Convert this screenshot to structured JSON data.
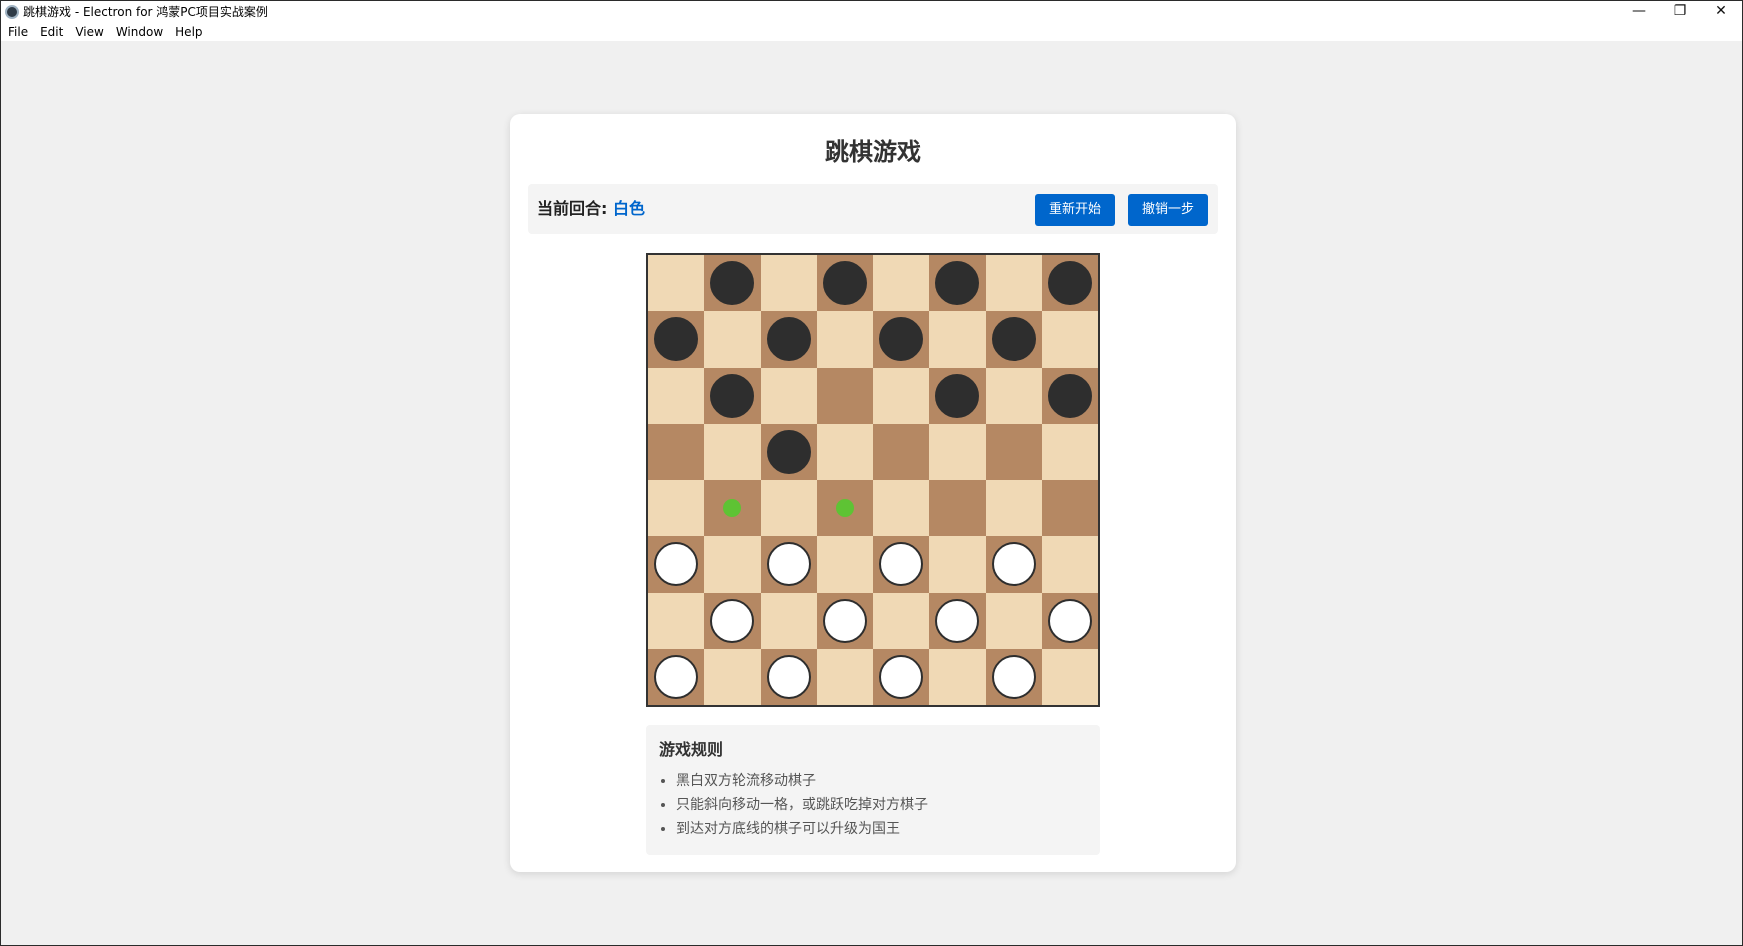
{
  "window": {
    "title": "跳棋游戏 - Electron for 鸿蒙PC项目实战案例",
    "minimize_glyph": "—",
    "restore_glyph": "❐",
    "close_glyph": "✕"
  },
  "menu": [
    "File",
    "Edit",
    "View",
    "Window",
    "Help"
  ],
  "game": {
    "title": "跳棋游戏",
    "turn_label": "当前回合: ",
    "turn_value": "白色",
    "restart_label": "重新开始",
    "undo_label": "撤销一步"
  },
  "board": {
    "size": 8,
    "light_color": "#f0d9b5",
    "dark_color": "#b58863",
    "rows": [
      ".B.B.B.B",
      "B.B.B.B.",
      ".B...B.B",
      "..B.....",
      ".*.*....",
      "W.W.W.W.",
      ".W.W.W.W",
      "W.W.W.W."
    ],
    "legend": {
      "B": "black-piece",
      "W": "white-piece",
      "*": "move-hint",
      ".": "empty"
    }
  },
  "rules": {
    "title": "游戏规则",
    "items": [
      "黑白双方轮流移动棋子",
      "只能斜向移动一格，或跳跃吃掉对方棋子",
      "到达对方底线的棋子可以升级为国王"
    ]
  },
  "colors": {
    "accent": "#0066cc",
    "hint": "#5ec334",
    "black_piece": "#2e2e2e",
    "white_piece": "#ffffff"
  }
}
